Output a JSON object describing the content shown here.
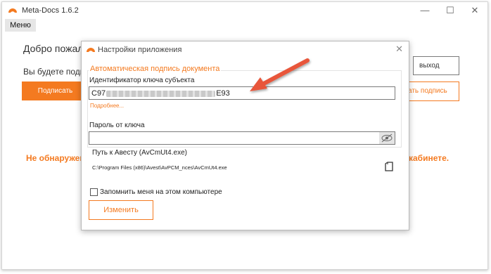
{
  "app": {
    "title": "Meta-Docs 1.6.2",
    "menu_label": "Меню"
  },
  "window_controls": {
    "minimize": "—",
    "maximize": "☐",
    "close": "✕"
  },
  "main": {
    "welcome": "Добро пожалов",
    "subtitle": "Вы будете подпи",
    "sign_button": "Подписать",
    "warning_left": "Не обнаружен",
    "warning_right": "кабинете.",
    "exit_button": "выход",
    "sign_outline_button": "ать подпись"
  },
  "dialog": {
    "title": "Настройки приложения",
    "close": "✕",
    "group_title": "Автоматическая подпись документа",
    "key_id_label": "Идентификатор ключа субъекта",
    "key_id_prefix": "C97",
    "key_id_suffix": "E93",
    "more_link": "Подробнее...",
    "password_label": "Пароль от ключа",
    "password_value": "",
    "path_label": "Путь к Авесту (AvCmUt4.exe)",
    "path_value": "C:\\Program Files (x86)\\Avest\\AvPCM_nces\\AvCmUt4.exe",
    "remember_label": "Запомнить меня на этом компьютере",
    "remember_checked": false,
    "change_button": "Изменить"
  },
  "colors": {
    "accent": "#f47a20",
    "arrow": "#e8573a"
  },
  "icons": [
    "app-logo-icon",
    "eye-icon",
    "browse-icon",
    "arrow-icon"
  ]
}
